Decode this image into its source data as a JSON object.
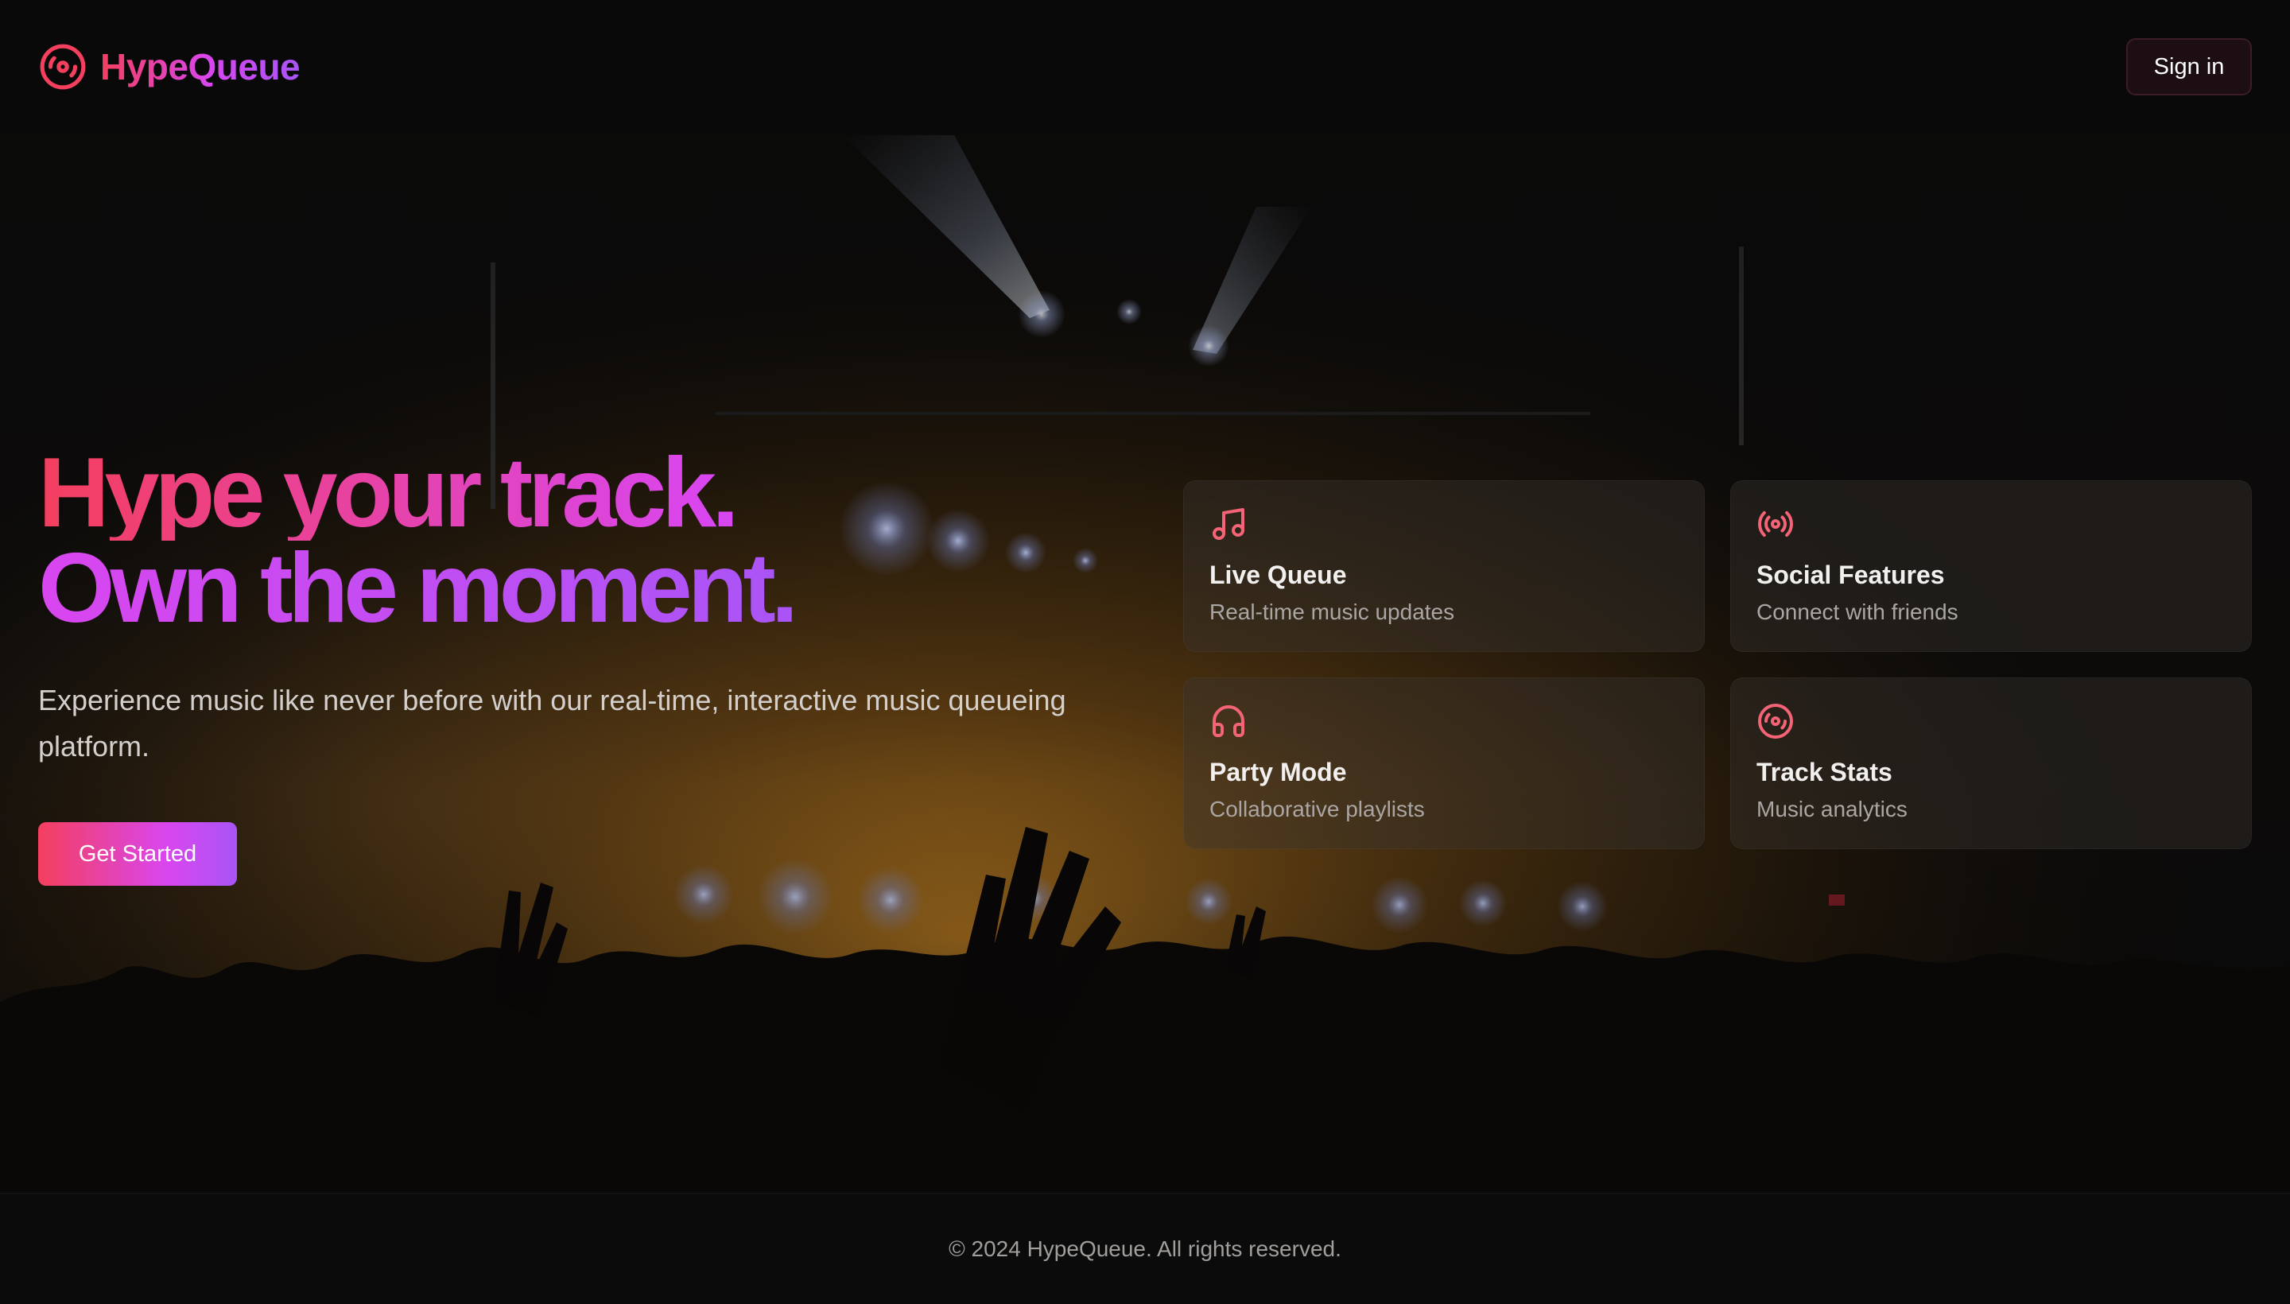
{
  "brand": {
    "name": "HypeQueue",
    "icon": "disc-icon"
  },
  "header": {
    "signin_label": "Sign in"
  },
  "hero": {
    "headline_line1": "Hype your track.",
    "headline_line2": "Own the moment.",
    "subtitle": "Experience music like never before with our real-time, interactive music queueing platform.",
    "cta_label": "Get Started"
  },
  "features": [
    {
      "icon": "music-note-icon",
      "title": "Live Queue",
      "description": "Real-time music updates"
    },
    {
      "icon": "broadcast-icon",
      "title": "Social Features",
      "description": "Connect with friends"
    },
    {
      "icon": "headphones-icon",
      "title": "Party Mode",
      "description": "Collaborative playlists"
    },
    {
      "icon": "disc-icon",
      "title": "Track Stats",
      "description": "Music analytics"
    }
  ],
  "footer": {
    "copyright": "© 2024 HypeQueue. All rights reserved."
  },
  "colors": {
    "accent_pink": "#f43f5e",
    "accent_purple": "#a855f7",
    "accent_magenta": "#d946ef",
    "background": "#0b0a0a",
    "icon_color": "#f46476"
  }
}
